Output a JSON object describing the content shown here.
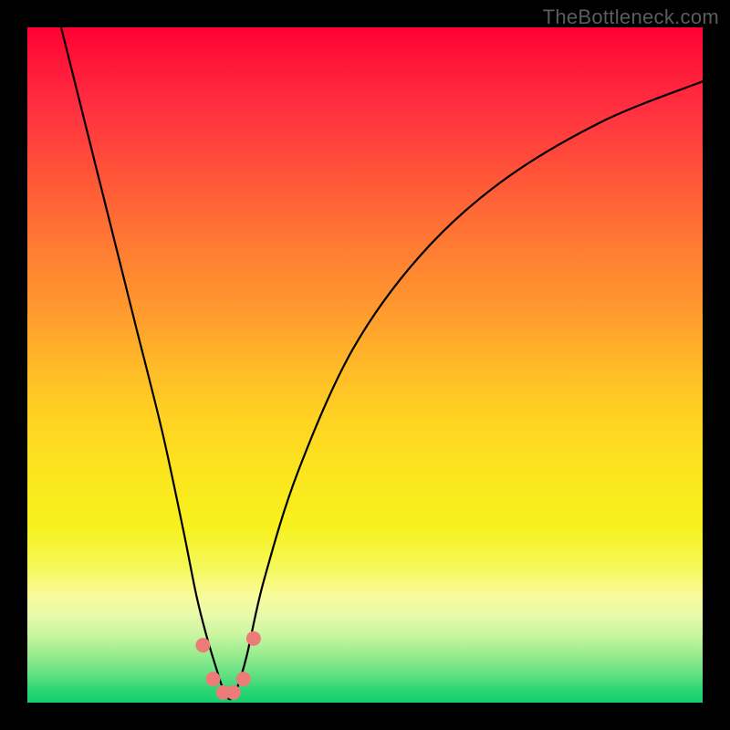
{
  "watermark": "TheBottleneck.com",
  "chart_data": {
    "type": "line",
    "title": "",
    "xlabel": "",
    "ylabel": "",
    "xlim": [
      0,
      100
    ],
    "ylim": [
      0,
      100
    ],
    "grid": false,
    "legend": false,
    "background_gradient": {
      "direction": "top-to-bottom",
      "stops": [
        {
          "pos": 0,
          "color": "#ff0033"
        },
        {
          "pos": 50,
          "color": "#ffb928"
        },
        {
          "pos": 80,
          "color": "#f5f85a"
        },
        {
          "pos": 100,
          "color": "#12cf6d"
        }
      ]
    },
    "series": [
      {
        "name": "bottleneck-curve",
        "x": [
          5,
          8,
          12,
          16,
          20,
          23,
          25,
          26.5,
          28,
          29,
          30,
          31,
          32.5,
          35,
          40,
          48,
          58,
          70,
          85,
          100
        ],
        "values": [
          100,
          88,
          72,
          56,
          40,
          26,
          16,
          10,
          5,
          2,
          0.5,
          2,
          7,
          18,
          34,
          52,
          66,
          77,
          86,
          92
        ]
      }
    ],
    "markers": [
      {
        "x": 26.0,
        "y": 8.5
      },
      {
        "x": 27.5,
        "y": 3.5
      },
      {
        "x": 29.0,
        "y": 1.5
      },
      {
        "x": 30.5,
        "y": 1.5
      },
      {
        "x": 32.0,
        "y": 3.5
      },
      {
        "x": 33.5,
        "y": 9.5
      }
    ],
    "marker_color": "#ed7b78",
    "curve_color": "#000000"
  }
}
